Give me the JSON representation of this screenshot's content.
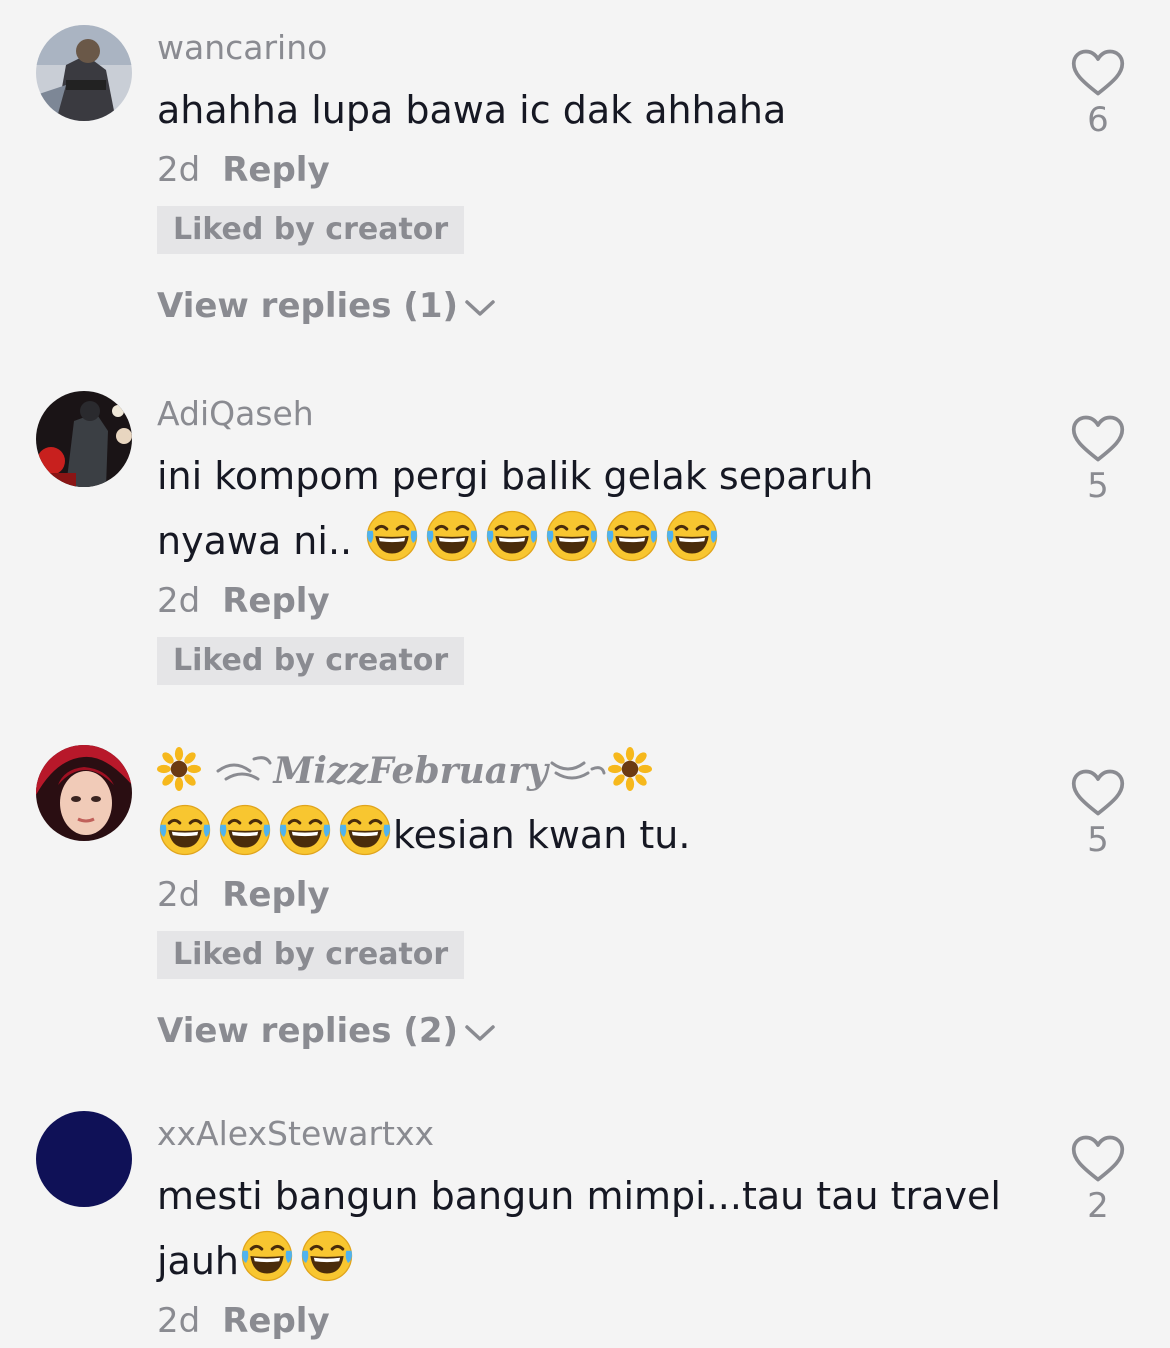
{
  "comments": [
    {
      "username": "wancarino",
      "text": "ahahha lupa bawa ic dak ahhaha",
      "time": "2d",
      "reply_label": "Reply",
      "liked_by_creator": "Liked by creator",
      "view_replies": "View replies (1)",
      "likes": "6",
      "emoji_count": 0
    },
    {
      "username": "AdiQaseh",
      "text_line1": "ini kompom pergi balik gelak separuh",
      "text_line2": "nyawa ni..",
      "time": "2d",
      "reply_label": "Reply",
      "liked_by_creator": "Liked by creator",
      "likes": "5",
      "emoji_count": 6
    },
    {
      "username_prefix": "🌻",
      "username": "MizzFebruary",
      "username_suffix": "🌻",
      "text": "kesian kwan tu.",
      "time": "2d",
      "reply_label": "Reply",
      "liked_by_creator": "Liked by creator",
      "view_replies": "View replies (2)",
      "likes": "5",
      "emoji_count": 4
    },
    {
      "username": "xxAlexStewartxx",
      "text_line1": "mesti bangun bangun mimpi...tau tau travel",
      "text_line2": "jauh",
      "time": "2d",
      "reply_label": "Reply",
      "likes": "2",
      "emoji_count": 2
    }
  ],
  "icons": {
    "like": "heart-outline-icon",
    "expand": "chevron-down-icon",
    "emoji": "face-with-tears-of-joy-emoji"
  },
  "colors": {
    "background": "#f4f4f4",
    "secondary_text": "#8a8b91",
    "primary_text": "#161823",
    "badge_bg": "#e5e5e7",
    "avatar_navy": "#0f1157"
  }
}
